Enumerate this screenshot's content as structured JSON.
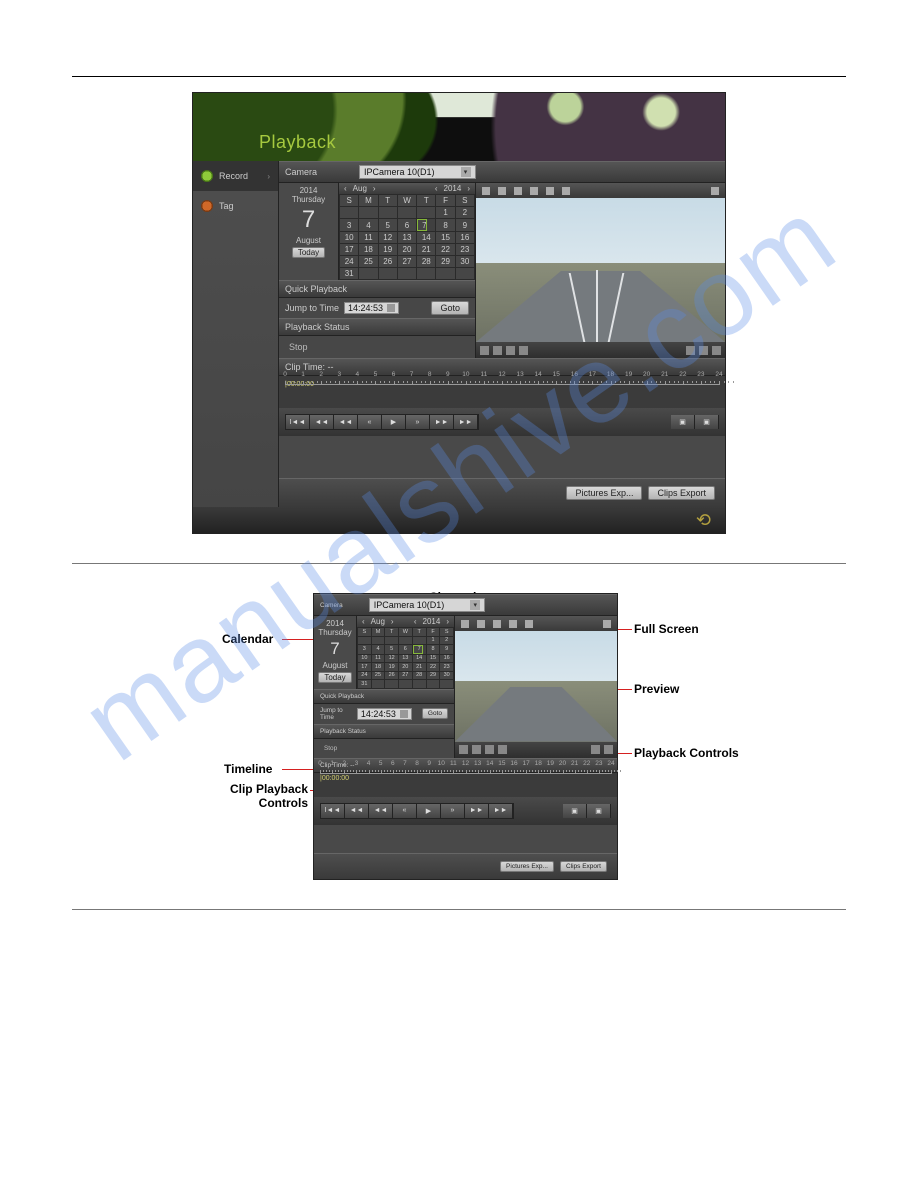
{
  "page_title": "Playback",
  "sidebar": {
    "items": [
      {
        "label": "Record",
        "active": true
      },
      {
        "label": "Tag",
        "active": false
      }
    ]
  },
  "camera_label": "Camera",
  "camera_value": "IPCamera 10(D1)",
  "date": {
    "year": "2014",
    "weekday": "Thursday",
    "daynum": "7",
    "month": "August",
    "today": "Today"
  },
  "cal": {
    "nav_month": "Aug",
    "nav_year": "2014",
    "dow": [
      "S",
      "M",
      "T",
      "W",
      "T",
      "F",
      "S"
    ],
    "weeks": [
      [
        "",
        "",
        "",
        "",
        "",
        "1",
        "2"
      ],
      [
        "3",
        "4",
        "5",
        "6",
        "7",
        "8",
        "9"
      ],
      [
        "10",
        "11",
        "12",
        "13",
        "14",
        "15",
        "16"
      ],
      [
        "17",
        "18",
        "19",
        "20",
        "21",
        "22",
        "23"
      ],
      [
        "24",
        "25",
        "26",
        "27",
        "28",
        "29",
        "30"
      ],
      [
        "31",
        "",
        "",
        "",
        "",
        "",
        ""
      ]
    ],
    "selected": "7"
  },
  "quick_playback": {
    "header": "Quick Playback",
    "jump_label": "Jump to Time",
    "time_value": "14:24:53",
    "goto": "Goto"
  },
  "status": {
    "header": "Playback Status",
    "value": "Stop"
  },
  "cliptime": "Clip Time: --",
  "timeline": {
    "start": "|00:00:00",
    "hours": [
      "0",
      "1",
      "2",
      "3",
      "4",
      "5",
      "6",
      "7",
      "8",
      "9",
      "10",
      "11",
      "12",
      "13",
      "14",
      "15",
      "16",
      "17",
      "18",
      "19",
      "20",
      "21",
      "22",
      "23",
      "24"
    ]
  },
  "clip_btns": [
    "I◄◄",
    "◄◄",
    "◄◄",
    "«",
    "▶",
    "»",
    "►►",
    "►►"
  ],
  "export": {
    "pictures": "Pictures Exp...",
    "clips": "Clips Export"
  },
  "annotations": {
    "channel": "Channel",
    "calendar": "Calendar",
    "fullscreen": "Full Screen",
    "preview": "Preview",
    "timeline": "Timeline",
    "clipctl": "Clip Playback Controls",
    "pbctl": "Playback Controls"
  }
}
